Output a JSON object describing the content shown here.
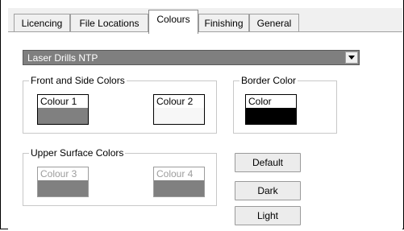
{
  "tabs": [
    {
      "label": "Licencing"
    },
    {
      "label": "File Locations"
    },
    {
      "label": "Colours",
      "active": true
    },
    {
      "label": "Finishing"
    },
    {
      "label": "General"
    }
  ],
  "preset_select": {
    "value": "Laser Drills NTP"
  },
  "front_side_group": {
    "title": "Front and Side Colors",
    "colour1": {
      "label": "Colour 1",
      "color": "#808080"
    },
    "colour2": {
      "label": "Colour 2",
      "color": "#f7f7f7"
    }
  },
  "border_group": {
    "title": "Border Color",
    "color": {
      "label": "Color",
      "color": "#000000"
    }
  },
  "upper_group": {
    "title": "Upper Surface Colors",
    "colour3": {
      "label": "Colour 3",
      "color": "#808080"
    },
    "colour4": {
      "label": "Colour 4",
      "color": "#808080"
    }
  },
  "buttons": {
    "default": "Default",
    "dark": "Dark",
    "light": "Light"
  }
}
